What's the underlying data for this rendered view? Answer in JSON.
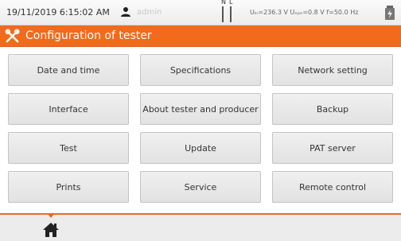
{
  "status_bar": {
    "datetime": "19/11/2019 6:15:02 AM",
    "user_icon": "user-icon",
    "username": "admin",
    "terminal_labels": {
      "n": "N",
      "l": "L"
    },
    "measurements": "Uₗₙ=236.3 V Uₙₚₑ=0.8 V f=50.0 Hz",
    "battery_icon": "battery-plug-icon"
  },
  "title_bar": {
    "icon": "settings-tools-icon",
    "title": "Configuration of tester"
  },
  "config_buttons": [
    {
      "label": "Date and time"
    },
    {
      "label": "Specifications"
    },
    {
      "label": "Network setting"
    },
    {
      "label": "Interface"
    },
    {
      "label": "About tester and producer"
    },
    {
      "label": "Backup"
    },
    {
      "label": "Test"
    },
    {
      "label": "Update"
    },
    {
      "label": "PAT server"
    },
    {
      "label": "Prints"
    },
    {
      "label": "Service"
    },
    {
      "label": "Remote control"
    }
  ],
  "bottom_bar": {
    "home_icon": "home-icon"
  },
  "colors": {
    "accent": "#f26b1d",
    "status_bg": "#f4f4f4",
    "button_bg": "#e8e8e8"
  }
}
